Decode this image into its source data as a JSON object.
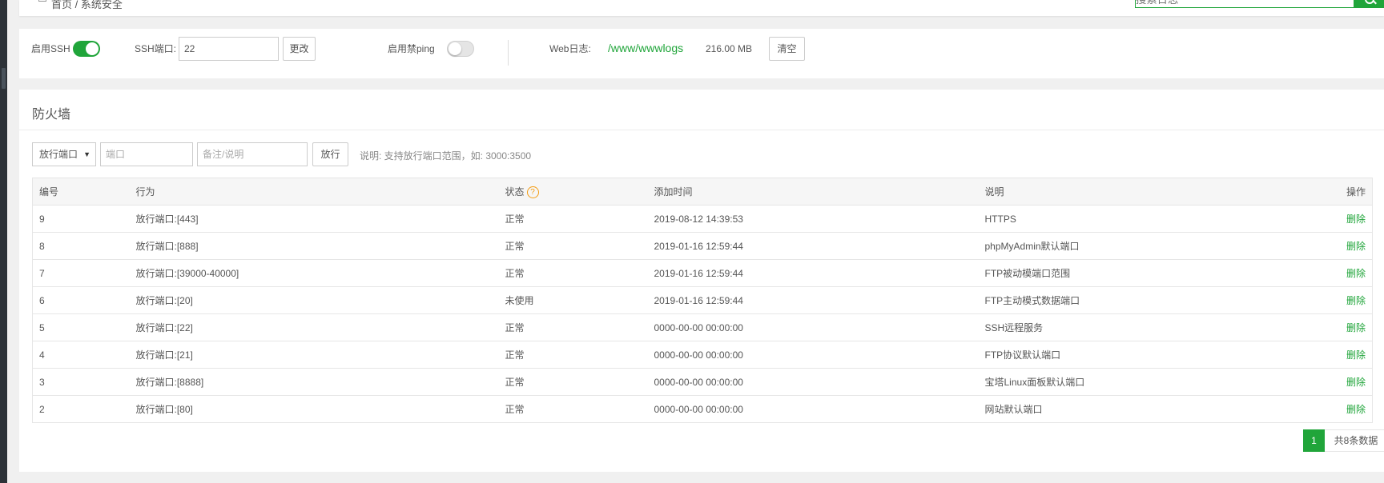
{
  "breadcrumb": {
    "text": "首页 / 系统安全"
  },
  "search": {
    "placeholder": "搜索日志"
  },
  "settings": {
    "ssh_label": "启用SSH",
    "ssh_enabled": true,
    "ssh_port_label": "SSH端口:",
    "ssh_port_value": "22",
    "change_button": "更改",
    "ping_label": "启用禁ping",
    "ping_enabled": false,
    "web_log_label": "Web日志:",
    "web_log_path": "/www/wwwlogs",
    "web_log_size": "216.00 MB",
    "clear_button": "清空"
  },
  "firewall": {
    "title": "防火墙",
    "rule_type": "放行端口",
    "port_placeholder": "端口",
    "note_placeholder": "备注/说明",
    "allow_button": "放行",
    "hint": "说明: 支持放行端口范围，如: 3000:3500",
    "columns": {
      "id": "编号",
      "action": "行为",
      "status": "状态",
      "status_help": "?",
      "added_time": "添加时间",
      "description": "说明",
      "operation": "操作"
    },
    "rows": [
      {
        "id": "9",
        "action": "放行端口:[443]",
        "status": "正常",
        "time": "2019-08-12 14:39:53",
        "desc": "HTTPS",
        "op": "删除"
      },
      {
        "id": "8",
        "action": "放行端口:[888]",
        "status": "正常",
        "time": "2019-01-16 12:59:44",
        "desc": "phpMyAdmin默认端口",
        "op": "删除"
      },
      {
        "id": "7",
        "action": "放行端口:[39000-40000]",
        "status": "正常",
        "time": "2019-01-16 12:59:44",
        "desc": "FTP被动模端口范围",
        "op": "删除"
      },
      {
        "id": "6",
        "action": "放行端口:[20]",
        "status": "未使用",
        "time": "2019-01-16 12:59:44",
        "desc": "FTP主动模式数据端口",
        "op": "删除"
      },
      {
        "id": "5",
        "action": "放行端口:[22]",
        "status": "正常",
        "time": "0000-00-00 00:00:00",
        "desc": "SSH远程服务",
        "op": "删除"
      },
      {
        "id": "4",
        "action": "放行端口:[21]",
        "status": "正常",
        "time": "0000-00-00 00:00:00",
        "desc": "FTP协议默认端口",
        "op": "删除"
      },
      {
        "id": "3",
        "action": "放行端口:[8888]",
        "status": "正常",
        "time": "0000-00-00 00:00:00",
        "desc": "宝塔Linux面板默认端口",
        "op": "删除"
      },
      {
        "id": "2",
        "action": "放行端口:[80]",
        "status": "正常",
        "time": "0000-00-00 00:00:00",
        "desc": "网站默认端口",
        "op": "删除"
      }
    ],
    "pagination": {
      "current": "1",
      "total_text": "共8条数据"
    }
  },
  "colors": {
    "accent": "#20a53a",
    "help": "#f39c12"
  }
}
